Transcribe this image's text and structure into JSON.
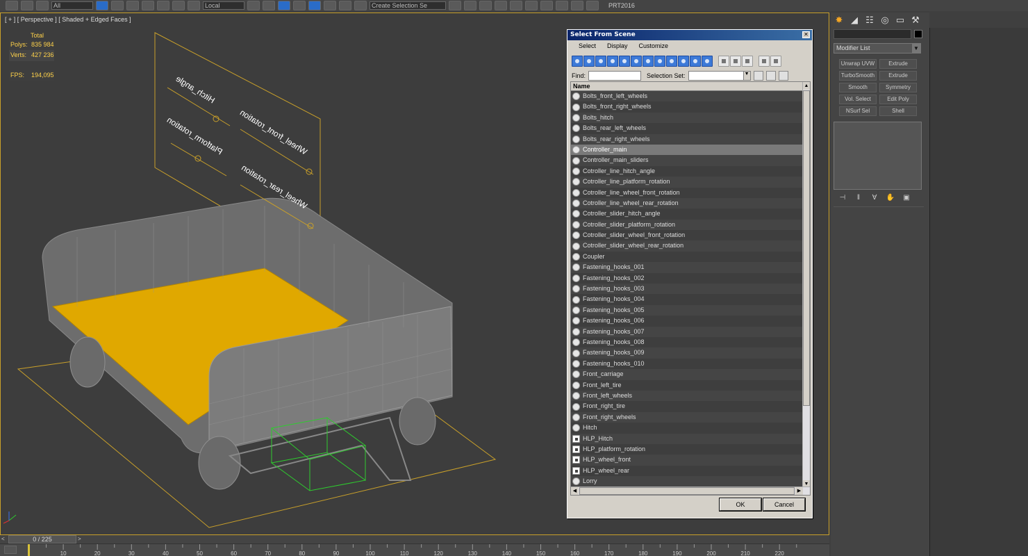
{
  "toolbar": {
    "filter_dropdown": "All",
    "coord_dropdown": "Local",
    "selection_set_dropdown": "Create Selection Se",
    "workspace_label": "PRT2016"
  },
  "viewport": {
    "label": "[ + ] [ Perspective ] [ Shaded + Edged Faces ]",
    "stats": {
      "total_label": "Total",
      "polys_label": "Polys:",
      "polys_value": "835 984",
      "verts_label": "Verts:",
      "verts_value": "427 236",
      "fps_label": "FPS:",
      "fps_value": "194,095"
    },
    "slider_labels": {
      "hitch": "Hitch_angle",
      "platform": "Platform_rotation",
      "wheel_front": "Wheel_front_rotation",
      "wheel_rear": "Wheel_rear_rotation"
    }
  },
  "command_panel": {
    "modifier_list": "Modifier List",
    "modifier_buttons": [
      "Unwrap UVW",
      "Extrude",
      "TurboSmooth",
      "Extrude",
      "Smooth",
      "Symmetry",
      "Vol. Select",
      "Edit Poly",
      "NSurf Sel",
      "Shell"
    ]
  },
  "timeline": {
    "frame_display": "0 / 225",
    "ticks": [
      "10",
      "20",
      "30",
      "40",
      "50",
      "60",
      "70",
      "80",
      "90",
      "100",
      "110",
      "120",
      "130",
      "140",
      "150",
      "160",
      "170",
      "180",
      "190",
      "200",
      "210",
      "220"
    ]
  },
  "dialog": {
    "title": "Select From Scene",
    "menu": [
      "Select",
      "Display",
      "Customize"
    ],
    "find_label": "Find:",
    "find_value": "",
    "selection_set_label": "Selection Set:",
    "column_name": "Name",
    "ok_label": "OK",
    "cancel_label": "Cancel",
    "selected_item": "Controller_main",
    "items": [
      {
        "name": "Bolts_front_left_wheels",
        "icon": "geometry"
      },
      {
        "name": "Bolts_front_right_wheels",
        "icon": "geometry"
      },
      {
        "name": "Bolts_hitch",
        "icon": "geometry"
      },
      {
        "name": "Bolts_rear_left_wheels",
        "icon": "geometry"
      },
      {
        "name": "Bolts_rear_right_wheels",
        "icon": "geometry"
      },
      {
        "name": "Controller_main",
        "icon": "shape"
      },
      {
        "name": "Controller_main_sliders",
        "icon": "shape"
      },
      {
        "name": "Cotroller_line_hitch_angle",
        "icon": "shape"
      },
      {
        "name": "Cotroller_line_platform_rotation",
        "icon": "shape"
      },
      {
        "name": "Cotroller_line_wheel_front_rotation",
        "icon": "shape"
      },
      {
        "name": "Cotroller_line_wheel_rear_rotation",
        "icon": "shape"
      },
      {
        "name": "Cotroller_slider_hitch_angle",
        "icon": "shape"
      },
      {
        "name": "Cotroller_slider_platform_rotation",
        "icon": "shape"
      },
      {
        "name": "Cotroller_slider_wheel_front_rotation",
        "icon": "shape"
      },
      {
        "name": "Cotroller_slider_wheel_rear_rotation",
        "icon": "shape"
      },
      {
        "name": "Coupler",
        "icon": "geometry"
      },
      {
        "name": "Fastening_hooks_001",
        "icon": "geometry"
      },
      {
        "name": "Fastening_hooks_002",
        "icon": "geometry"
      },
      {
        "name": "Fastening_hooks_003",
        "icon": "geometry"
      },
      {
        "name": "Fastening_hooks_004",
        "icon": "geometry"
      },
      {
        "name": "Fastening_hooks_005",
        "icon": "geometry"
      },
      {
        "name": "Fastening_hooks_006",
        "icon": "geometry"
      },
      {
        "name": "Fastening_hooks_007",
        "icon": "geometry"
      },
      {
        "name": "Fastening_hooks_008",
        "icon": "geometry"
      },
      {
        "name": "Fastening_hooks_009",
        "icon": "geometry"
      },
      {
        "name": "Fastening_hooks_010",
        "icon": "geometry"
      },
      {
        "name": "Front_carriage",
        "icon": "geometry"
      },
      {
        "name": "Front_left_tire",
        "icon": "geometry"
      },
      {
        "name": "Front_left_wheels",
        "icon": "geometry"
      },
      {
        "name": "Front_right_tire",
        "icon": "geometry"
      },
      {
        "name": "Front_right_wheels",
        "icon": "geometry"
      },
      {
        "name": "Hitch",
        "icon": "geometry"
      },
      {
        "name": "HLP_Hitch",
        "icon": "helper"
      },
      {
        "name": "HLP_platform_rotation",
        "icon": "helper"
      },
      {
        "name": "HLP_wheel_front",
        "icon": "helper"
      },
      {
        "name": "HLP_wheel_rear",
        "icon": "helper"
      },
      {
        "name": "Lorry",
        "icon": "geometry"
      }
    ]
  },
  "colors": {
    "viewport_border": "#c9a02a",
    "stats_text": "#ffd24a",
    "floor_yellow": "#e0a800",
    "selection_green": "#2ecc2e",
    "title_bar": "#0a246a"
  }
}
